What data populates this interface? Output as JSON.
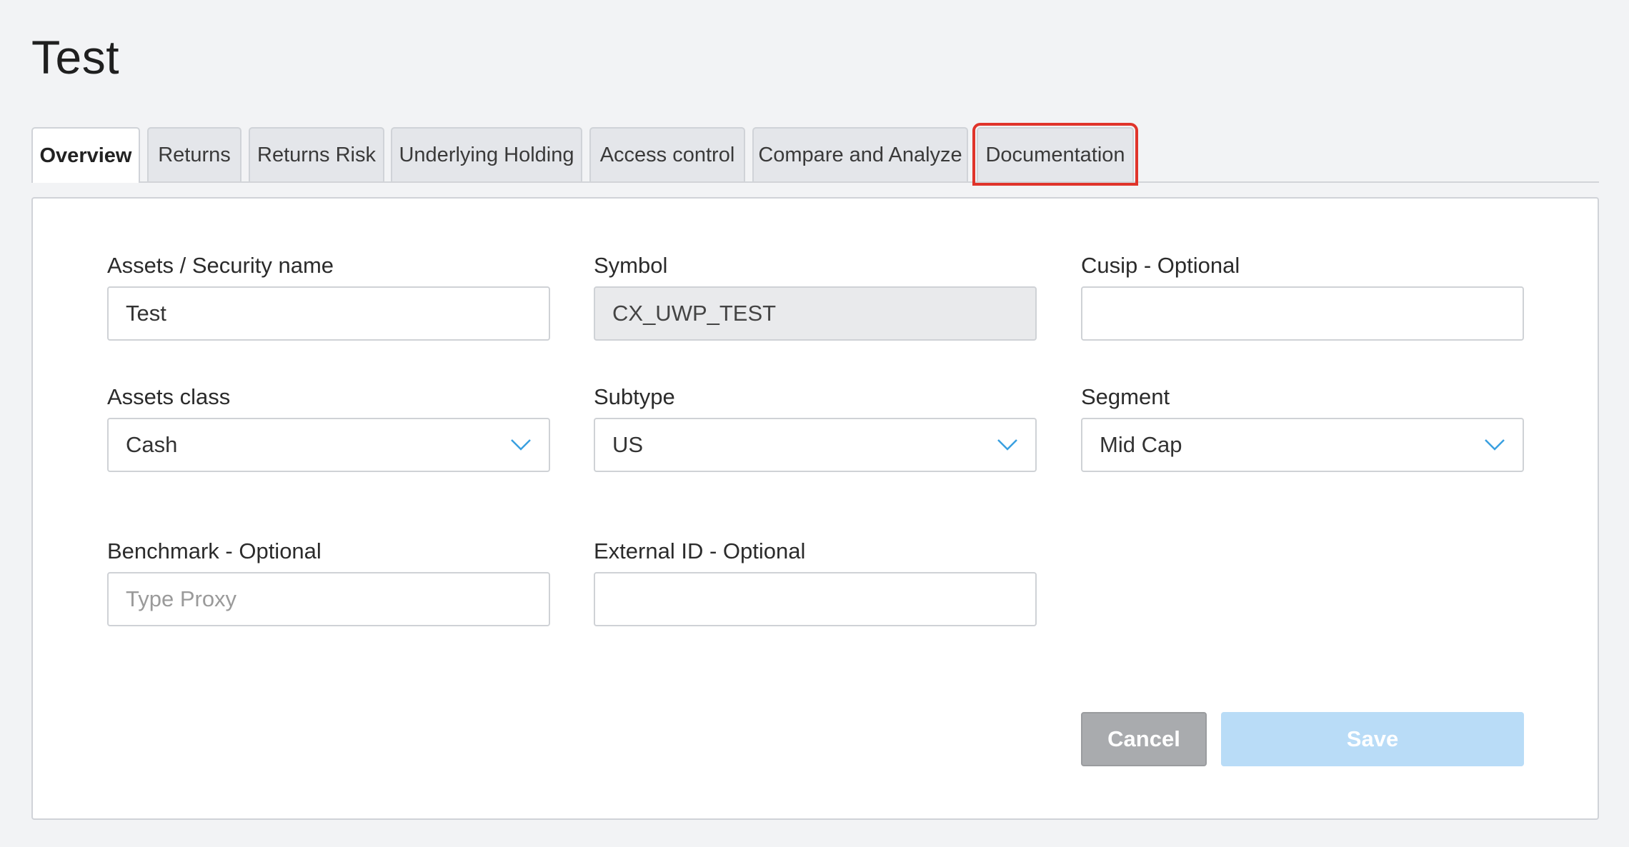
{
  "page": {
    "title": "Test"
  },
  "tabs": [
    {
      "label": "Overview",
      "active": true
    },
    {
      "label": "Returns"
    },
    {
      "label": "Returns Risk"
    },
    {
      "label": "Underlying Holding"
    },
    {
      "label": "Access control"
    },
    {
      "label": "Compare and Analyze"
    },
    {
      "label": "Documentation",
      "highlighted": true
    }
  ],
  "form": {
    "security_name": {
      "label": "Assets / Security name",
      "value": "Test"
    },
    "symbol": {
      "label": "Symbol",
      "value": "CX_UWP_TEST"
    },
    "cusip": {
      "label": "Cusip - Optional",
      "value": ""
    },
    "asset_class": {
      "label": "Assets class",
      "value": "Cash"
    },
    "subtype": {
      "label": "Subtype",
      "value": "US"
    },
    "segment": {
      "label": "Segment",
      "value": "Mid Cap"
    },
    "benchmark": {
      "label": "Benchmark - Optional",
      "value": "",
      "placeholder": "Type Proxy"
    },
    "external_id": {
      "label": "External ID - Optional",
      "value": ""
    }
  },
  "actions": {
    "cancel_label": "Cancel",
    "save_label": "Save"
  },
  "colors": {
    "highlight": "#e0342b",
    "chevron": "#3aa0e0",
    "save_disabled": "#b9dcf7",
    "cancel": "#a9abae"
  },
  "icons": {
    "select_chevron": "chevron-down-icon"
  }
}
